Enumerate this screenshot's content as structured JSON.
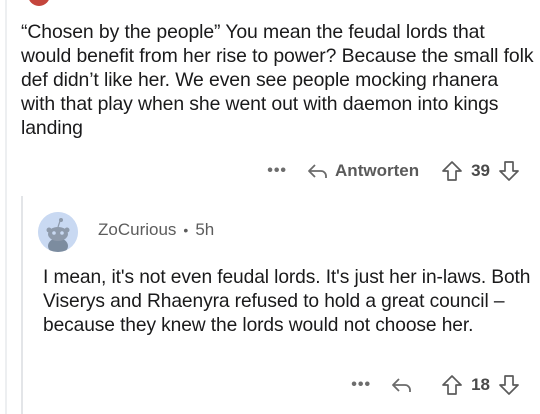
{
  "comment1": {
    "text": "“Chosen by the people” You mean the feudal lords that would benefit from her rise to power? Because the small folk def didn’t like her. We even see people mocking rhanera with that play when she went out with daemon into kings landing",
    "more": "•••",
    "reply_label": "Antworten",
    "score": "39"
  },
  "comment2": {
    "username": "ZoCurious",
    "separator": "•",
    "time": "5h",
    "text": "I mean, it's not even feudal lords. It's just her in-laws. Both Viserys and Rhaenyra refused to hold a great council – because they knew the lords would not choose her.",
    "more": "•••",
    "score": "18"
  },
  "icons": {
    "reply": "reply-arrow-icon",
    "upvote": "upvote-arrow-icon",
    "downvote": "downvote-arrow-icon",
    "avatar": "snoo-avatar-icon"
  },
  "colors": {
    "text": "#1a1a1b",
    "muted": "#5e5e5e",
    "avatar_bg": "#c9d9f2",
    "top_avatar": "#c4453c"
  }
}
